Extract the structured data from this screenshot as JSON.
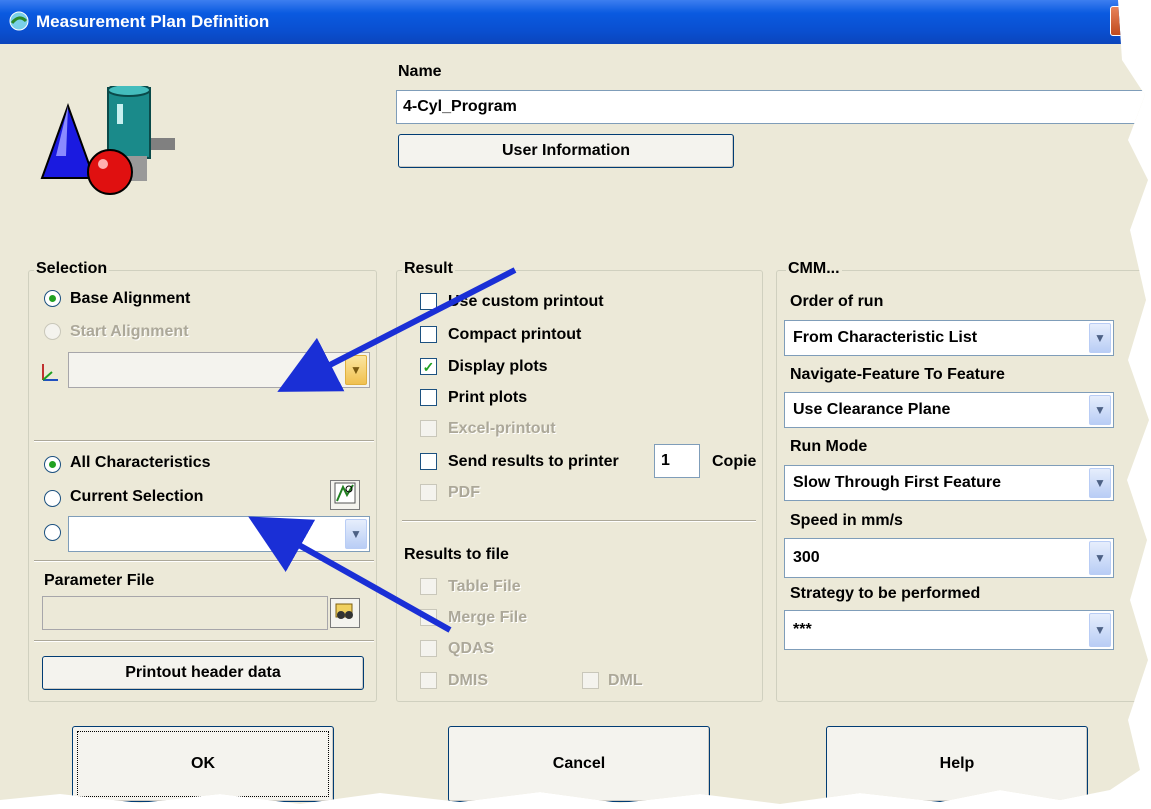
{
  "window": {
    "title": "Measurement Plan Definition"
  },
  "name_section": {
    "label": "Name",
    "value": "4-Cyl_Program",
    "user_info_button": "User Information"
  },
  "selection": {
    "title": "Selection",
    "base_alignment": "Base Alignment",
    "start_alignment": "Start Alignment",
    "alignment_value": "",
    "all_characteristics": "All Characteristics",
    "current_selection": "Current Selection",
    "third_value": "",
    "parameter_file_label": "Parameter File",
    "parameter_file_value": "",
    "printout_header_button": "Printout header data"
  },
  "result": {
    "title": "Result",
    "use_custom_printout": "Use custom printout",
    "compact_printout": "Compact printout",
    "display_plots": "Display plots",
    "print_plots": "Print plots",
    "excel_printout": "Excel-printout",
    "send_results": "Send results to printer",
    "copies_value": "1",
    "copies_label": "Copie",
    "pdf": "PDF",
    "results_to_file": "Results to file",
    "table_file": "Table File",
    "merge_file": "Merge File",
    "qdas": "QDAS",
    "dmis": "DMIS",
    "dml": "DML"
  },
  "cmm": {
    "title": "CMM...",
    "order_of_run_label": "Order of run",
    "order_of_run_value": "From Characteristic List",
    "navigate_label": "Navigate-Feature To Feature",
    "navigate_value": "Use Clearance Plane",
    "run_mode_label": "Run Mode",
    "run_mode_value": "Slow Through First Feature",
    "speed_label": "Speed in mm/s",
    "speed_value": "300",
    "strategy_label": "Strategy to be performed",
    "strategy_value": "***"
  },
  "buttons": {
    "ok": "OK",
    "cancel": "Cancel",
    "help": "Help"
  },
  "colors": {
    "titlebar": "#0a4fd0",
    "dialog_bg": "#ece9d8",
    "annotation_arrow": "#1a2fd6"
  }
}
